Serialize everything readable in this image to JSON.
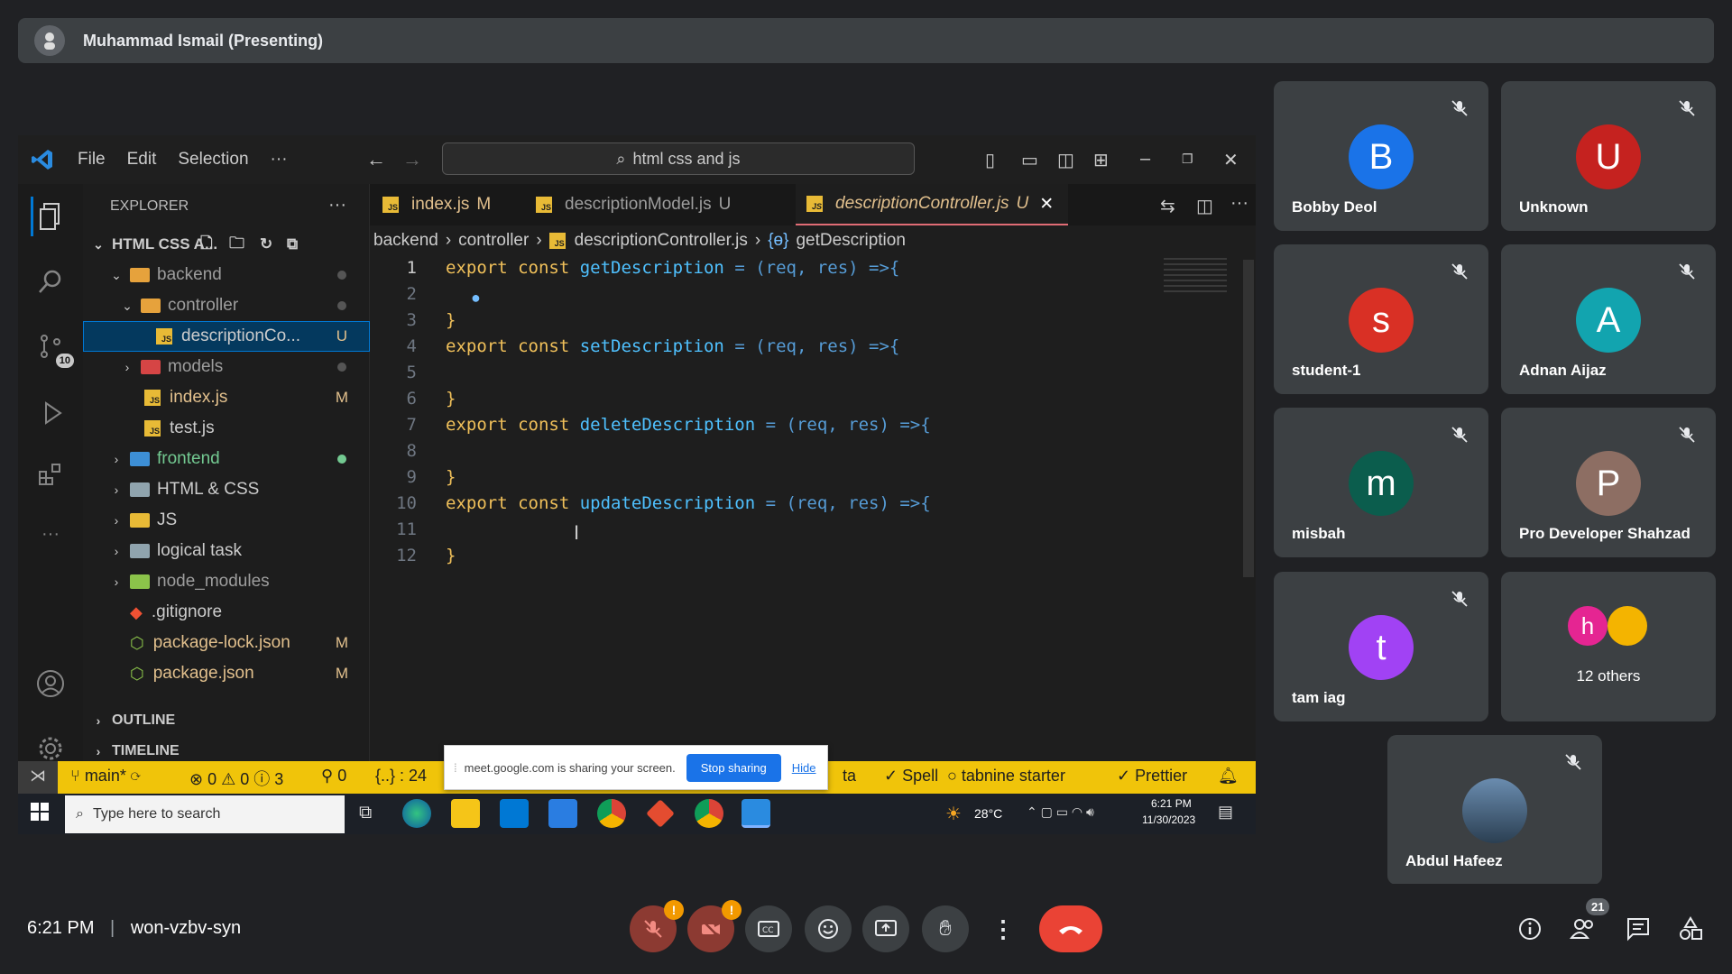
{
  "meeting": {
    "presenter": "Muhammad Ismail (Presenting)",
    "time": "6:21 PM",
    "code": "won-vzbv-syn",
    "people_count": "21"
  },
  "vscode": {
    "menu": [
      "File",
      "Edit",
      "Selection",
      "···"
    ],
    "search": "html css and js",
    "explorer_title": "EXPLORER",
    "project": "HTML CSS A...",
    "tree": [
      {
        "name": "backend",
        "type": "folder-open",
        "badge": ""
      },
      {
        "name": "controller",
        "type": "folder-open",
        "badge": ""
      },
      {
        "name": "descriptionCo...",
        "type": "js",
        "badge": "U"
      },
      {
        "name": "models",
        "type": "folder",
        "badge": ""
      },
      {
        "name": "index.js",
        "type": "js",
        "badge": "M"
      },
      {
        "name": "test.js",
        "type": "js",
        "badge": ""
      },
      {
        "name": "frontend",
        "type": "folder",
        "badge": ""
      },
      {
        "name": "HTML & CSS",
        "type": "folder",
        "badge": ""
      },
      {
        "name": "JS",
        "type": "folder",
        "badge": ""
      },
      {
        "name": "logical task",
        "type": "folder",
        "badge": ""
      },
      {
        "name": "node_modules",
        "type": "folder",
        "badge": ""
      },
      {
        "name": ".gitignore",
        "type": "git",
        "badge": ""
      },
      {
        "name": "package-lock.json",
        "type": "json",
        "badge": "M"
      },
      {
        "name": "package.json",
        "type": "json",
        "badge": "M"
      }
    ],
    "outline": "OUTLINE",
    "timeline": "TIMELINE",
    "scm_badge": "10",
    "tabs": [
      {
        "label": "index.js",
        "badge": "M"
      },
      {
        "label": "descriptionModel.js",
        "badge": "U"
      },
      {
        "label": "descriptionController.js",
        "badge": "U"
      }
    ],
    "breadcrumb": [
      "backend",
      "controller",
      "descriptionController.js",
      "getDescription"
    ],
    "code": [
      {
        "n": "1",
        "kw": "export const ",
        "fn": "getDescription",
        "rest": " = (req, res) =>{"
      },
      {
        "n": "2",
        "kw": "",
        "fn": "",
        "rest": ""
      },
      {
        "n": "3",
        "kw": "",
        "fn": "",
        "rest": "}"
      },
      {
        "n": "4",
        "kw": "export const ",
        "fn": "setDescription",
        "rest": " = (req, res) =>{"
      },
      {
        "n": "5",
        "kw": "",
        "fn": "",
        "rest": ""
      },
      {
        "n": "6",
        "kw": "",
        "fn": "",
        "rest": "}"
      },
      {
        "n": "7",
        "kw": "export const ",
        "fn": "deleteDescription",
        "rest": " = (req, res) =>{"
      },
      {
        "n": "8",
        "kw": "",
        "fn": "",
        "rest": ""
      },
      {
        "n": "9",
        "kw": "",
        "fn": "",
        "rest": "}"
      },
      {
        "n": "10",
        "kw": "export const ",
        "fn": "updateDescription",
        "rest": " = (req, res) =>{"
      },
      {
        "n": "11",
        "kw": "",
        "fn": "",
        "rest": ""
      },
      {
        "n": "12",
        "kw": "",
        "fn": "",
        "rest": "}"
      }
    ],
    "status": {
      "branch": "main*",
      "errors": "0",
      "warnings": "0",
      "infos": "3",
      "ports": "0",
      "braces": "{..} : 24",
      "ta": "ta",
      "spell": "Spell",
      "tabnine": "tabnine starter",
      "prettier": "Prettier"
    }
  },
  "share_notice": {
    "text": "meet.google.com is sharing your screen.",
    "stop": "Stop sharing",
    "hide": "Hide"
  },
  "taskbar": {
    "search": "Type here to search",
    "weather": "28°C",
    "clock_time": "6:21 PM",
    "clock_date": "11/30/2023"
  },
  "participants": [
    {
      "initial": "B",
      "name": "Bobby Deol",
      "color": "#1a73e8"
    },
    {
      "initial": "U",
      "name": "Unknown",
      "color": "#c5221f"
    },
    {
      "initial": "s",
      "name": "student-1",
      "color": "#d93025"
    },
    {
      "initial": "A",
      "name": "Adnan Aijaz",
      "color": "#12a4af"
    },
    {
      "initial": "m",
      "name": "misbah",
      "color": "#0b5d4d"
    },
    {
      "initial": "P",
      "name": "Pro Developer Shahzad",
      "color": "#8d6e63"
    },
    {
      "initial": "t",
      "name": "tam iag",
      "color": "#a142f4"
    },
    {
      "initial": "h",
      "name": "12 others",
      "color": "#e52592"
    },
    {
      "initial": "",
      "name": "Abdul Hafeez",
      "color": "#2b3f52"
    }
  ]
}
